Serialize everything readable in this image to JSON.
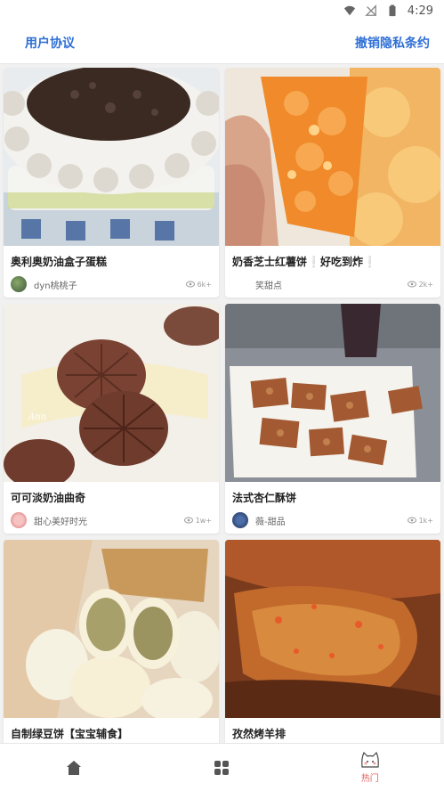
{
  "status_bar": {
    "time": "4:29"
  },
  "header": {
    "left_link": "用户协议",
    "right_link": "撤销隐私条约"
  },
  "cards": [
    {
      "title": "奥利奥奶油盒子蛋糕",
      "author": "dyn桃桃子",
      "views": "6k+"
    },
    {
      "title": "奶香芝士红薯饼❕好吃到炸❕",
      "author": "笑甜点",
      "views": "2k+"
    },
    {
      "title": "可可淡奶油曲奇",
      "author": "甜心美好时光",
      "views": "1w+"
    },
    {
      "title": "法式杏仁酥饼",
      "author": "薇-甜品",
      "views": "1k+"
    },
    {
      "title": "自制绿豆饼【宝宝辅食】",
      "author": "",
      "views": ""
    },
    {
      "title": "孜然烤羊排",
      "author": "",
      "views": ""
    }
  ],
  "bottom_nav": [
    {
      "icon": "home-icon",
      "label": ""
    },
    {
      "icon": "grid-icon",
      "label": ""
    },
    {
      "icon": "cat-face-icon",
      "label": "热门"
    }
  ],
  "colors": {
    "accent_link": "#2f6fd6",
    "active_nav": "#e26262"
  }
}
